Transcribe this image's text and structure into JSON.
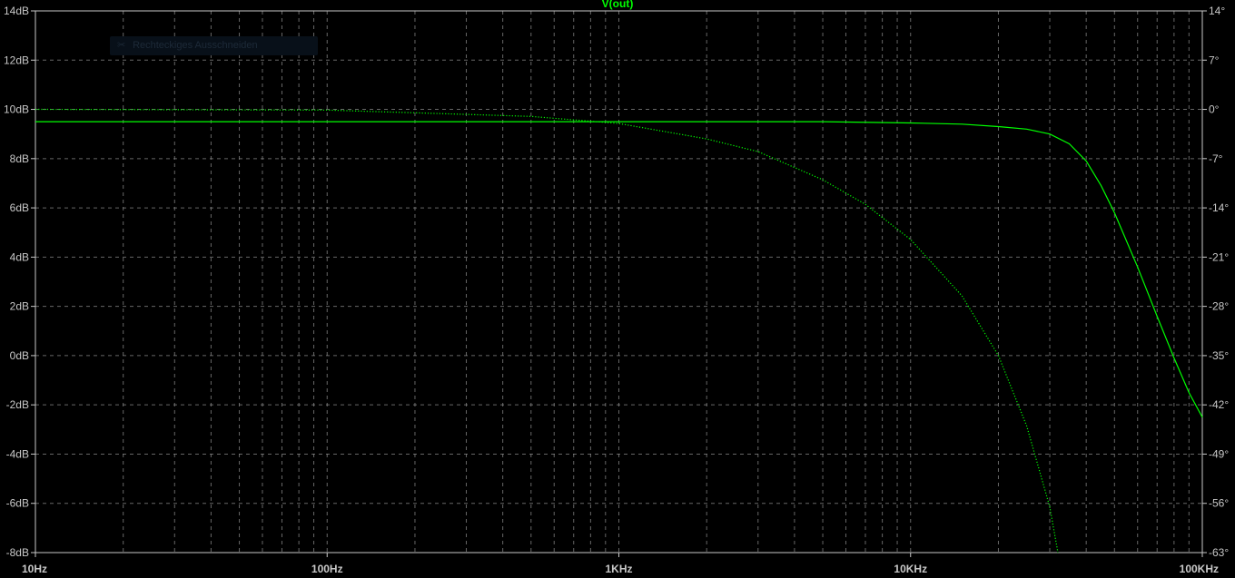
{
  "chart_data": {
    "type": "line",
    "title": "V(out)",
    "x_scale": "log",
    "xlim": [
      10,
      100000
    ],
    "x_ticks": [
      {
        "value": 10,
        "label": "10Hz"
      },
      {
        "value": 100,
        "label": "100Hz"
      },
      {
        "value": 1000,
        "label": "1KHz"
      },
      {
        "value": 10000,
        "label": "10KHz"
      },
      {
        "value": 100000,
        "label": "100KHz"
      }
    ],
    "y_left": {
      "lim": [
        -8,
        14
      ],
      "ticks": [
        "14dB",
        "12dB",
        "10dB",
        "8dB",
        "6dB",
        "4dB",
        "2dB",
        "0dB",
        "-2dB",
        "-4dB",
        "-6dB",
        "-8dB"
      ]
    },
    "y_right": {
      "lim": [
        -63,
        14
      ],
      "ticks": [
        "14°",
        "7°",
        "0°",
        "-7°",
        "-14°",
        "-21°",
        "-28°",
        "-35°",
        "-42°",
        "-49°",
        "-56°",
        "-63°"
      ]
    },
    "grid": true,
    "series": [
      {
        "axis": "left",
        "style": "solid",
        "color": "#00ff00",
        "x": [
          10,
          100,
          1000,
          5000,
          10000,
          15000,
          20000,
          25000,
          30000,
          35000,
          40000,
          45000,
          50000,
          60000,
          70000,
          80000,
          90000,
          100000
        ],
        "y": [
          9.5,
          9.5,
          9.5,
          9.5,
          9.45,
          9.4,
          9.3,
          9.2,
          9.0,
          8.6,
          7.9,
          6.9,
          5.8,
          3.6,
          1.6,
          -0.1,
          -1.5,
          -2.5
        ]
      },
      {
        "axis": "right",
        "style": "dotted",
        "color": "#00ff00",
        "x": [
          10,
          100,
          500,
          1000,
          2000,
          3000,
          5000,
          7000,
          10000,
          15000,
          20000,
          25000,
          30000,
          32000
        ],
        "y": [
          0,
          -0.1,
          -1.0,
          -2.0,
          -4.2,
          -6.0,
          -10.0,
          -13.5,
          -18.5,
          -26.5,
          -35.0,
          -45.0,
          -56.5,
          -63.0
        ]
      }
    ]
  },
  "overlay": {
    "icon": "snip-icon",
    "text": "Rechteckiges Ausschneiden"
  }
}
